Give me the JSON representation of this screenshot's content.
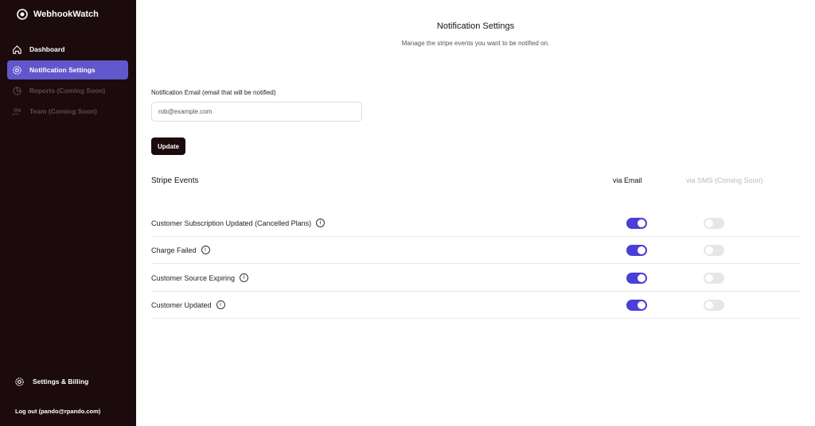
{
  "app": {
    "name": "WebhookWatch"
  },
  "sidebar": {
    "items": [
      {
        "label": "Dashboard"
      },
      {
        "label": "Notification Settings"
      },
      {
        "label": "Reports (Coming Soon)"
      },
      {
        "label": "Team (Coming Soon)"
      }
    ],
    "settings": "Settings & Billing",
    "logout": "Log out (pando@rpando.com)"
  },
  "main": {
    "title": "Notification Settings",
    "subtitle": "Manage the stripe events you want to be notified on.",
    "email_label": "Notification Email (email that will be notified)",
    "email_value": "rob@example.com",
    "update": "Update",
    "events_heading": "Stripe Events",
    "col_email": "via Email",
    "col_sms": "via SMS (Coming Soon)",
    "events": [
      {
        "label": "Customer Subscription Updated (Cancelled Plans)",
        "email": true,
        "sms": false
      },
      {
        "label": "Charge Failed",
        "email": true,
        "sms": false
      },
      {
        "label": "Customer Source Expiring",
        "email": true,
        "sms": false
      },
      {
        "label": "Customer Updated",
        "email": true,
        "sms": false
      }
    ]
  },
  "colors": {
    "accent": "#6157cc",
    "toggle": "#4a3fd8",
    "sidebar": "#1c0b0c"
  }
}
